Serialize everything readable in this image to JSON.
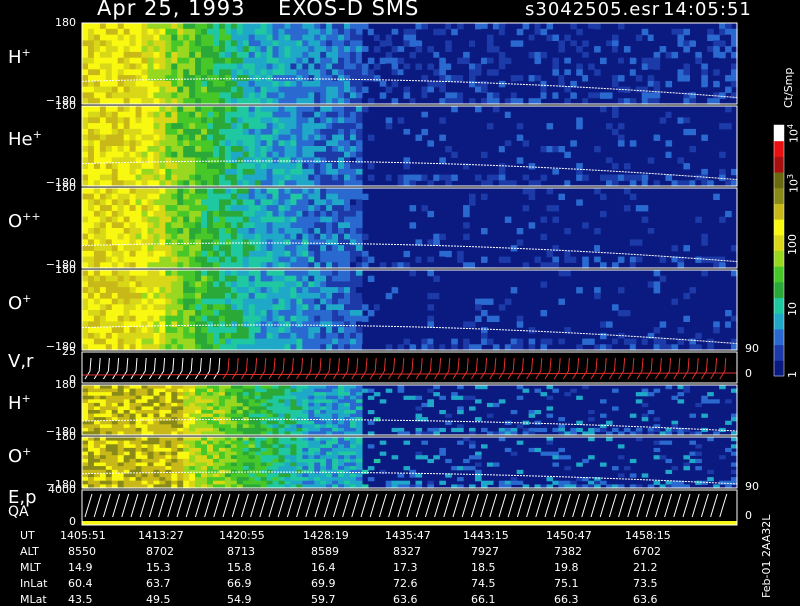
{
  "title": {
    "date": "Apr 25, 1993",
    "instrument": "EXOS-D SMS",
    "file": "s3042505.esr",
    "time": "14:05:51"
  },
  "colorbar": {
    "unit_label": "Ct/Smp",
    "tick_labels": [
      "1",
      "10",
      "100",
      "10",
      "3",
      "10",
      "4"
    ],
    "ticks": [
      {
        "base": "1",
        "exp": ""
      },
      {
        "base": "10",
        "exp": ""
      },
      {
        "base": "100",
        "exp": ""
      },
      {
        "base": "10",
        "exp": "3"
      },
      {
        "base": "10",
        "exp": "4"
      }
    ],
    "colors": [
      "#0a1a80",
      "#1c3aa8",
      "#2a6ad0",
      "#1fa8c8",
      "#1fc8a0",
      "#2aa838",
      "#48c828",
      "#98d820",
      "#d8d818",
      "#f8f810",
      "#c8b818",
      "#8a8a18",
      "#6a6a10",
      "#a81010",
      "#e81010",
      "#ffffff"
    ]
  },
  "panels": [
    {
      "id": "h1",
      "ion": "H",
      "charge": "+",
      "ymax": "180",
      "ymin": "−180"
    },
    {
      "id": "he",
      "ion": "He",
      "charge": "+",
      "ymax": "180",
      "ymin": "−180"
    },
    {
      "id": "opp",
      "ion": "O",
      "charge": "++",
      "ymax": "180",
      "ymin": "−180"
    },
    {
      "id": "o1",
      "ion": "O",
      "charge": "+",
      "ymax": "180",
      "ymin": "−180",
      "rlabel": "90"
    },
    {
      "id": "vr",
      "ion": "V,r",
      "charge": "",
      "ymax": "25",
      "ymin": "0",
      "rlabel": "0"
    },
    {
      "id": "h2",
      "ion": "H",
      "charge": "+",
      "ymax": "180",
      "ymin": "−180"
    },
    {
      "id": "o2",
      "ion": "O",
      "charge": "+",
      "ymax": "180",
      "ymin": "−180",
      "rlabel": "90"
    },
    {
      "id": "ep",
      "ion": "E,p",
      "ion2": "QA",
      "charge": "",
      "ymax": "4000",
      "ymin": "0",
      "rlabel": "0"
    }
  ],
  "footer": {
    "row_labels": [
      "UT",
      "ALT",
      "MLT",
      "InLat",
      "MLat"
    ],
    "columns": [
      {
        "UT": "1405:51",
        "ALT": "8550",
        "MLT": "14.9",
        "InLat": "60.4",
        "MLat": "43.5"
      },
      {
        "UT": "1413:27",
        "ALT": "8702",
        "MLT": "15.3",
        "InLat": "63.7",
        "MLat": "49.5"
      },
      {
        "UT": "1420:55",
        "ALT": "8713",
        "MLT": "15.8",
        "InLat": "66.9",
        "MLat": "54.9"
      },
      {
        "UT": "1428:19",
        "ALT": "8589",
        "MLT": "16.4",
        "InLat": "69.9",
        "MLat": "59.7"
      },
      {
        "UT": "1435:47",
        "ALT": "8327",
        "MLT": "17.3",
        "InLat": "72.6",
        "MLat": "63.6"
      },
      {
        "UT": "1443:15",
        "ALT": "7927",
        "MLT": "18.5",
        "InLat": "74.5",
        "MLat": "66.1"
      },
      {
        "UT": "1450:47",
        "ALT": "7382",
        "MLT": "19.8",
        "InLat": "75.1",
        "MLat": "66.3"
      },
      {
        "UT": "1458:15",
        "ALT": "6702",
        "MLT": "21.2",
        "InLat": "73.5",
        "MLat": "63.6"
      }
    ],
    "side_note": "Feb-01 2AA32L"
  },
  "chart_data": {
    "type": "heatmap",
    "title": "Apr 25, 1993   EXOS-D SMS",
    "x": [
      "1405:51",
      "1413:27",
      "1420:55",
      "1428:19",
      "1435:47",
      "1443:15",
      "1450:47",
      "1458:15"
    ],
    "xlabel": "UT",
    "colorbar_label": "Ct/Smp",
    "colorbar_range": [
      1,
      10000
    ],
    "colorbar_log": true,
    "series": [
      {
        "name": "H+",
        "ylim": [
          -180,
          180
        ]
      },
      {
        "name": "He+",
        "ylim": [
          -180,
          180
        ]
      },
      {
        "name": "O++",
        "ylim": [
          -180,
          180
        ]
      },
      {
        "name": "O+",
        "ylim": [
          -180,
          180
        ]
      },
      {
        "name": "V,r",
        "ylim": [
          0,
          25
        ]
      },
      {
        "name": "H+",
        "ylim": [
          -180,
          180
        ]
      },
      {
        "name": "O+",
        "ylim": [
          -180,
          180
        ]
      },
      {
        "name": "E,p",
        "ylim": [
          0,
          4000
        ]
      }
    ]
  }
}
